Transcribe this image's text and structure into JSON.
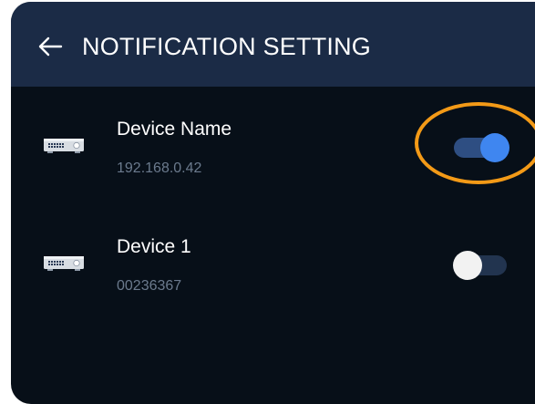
{
  "header": {
    "title": "NOTIFICATION SETTING",
    "back_icon": "arrow-left-icon"
  },
  "devices": [
    {
      "name": "Device Name",
      "sub": "192.168.0.42",
      "icon": "dvr-recorder-icon",
      "enabled": true
    },
    {
      "name": "Device 1",
      "sub": "00236367",
      "icon": "dvr-recorder-icon",
      "enabled": false
    }
  ],
  "colors": {
    "header_bg": "#1b2b46",
    "body_bg": "#070f18",
    "toggle_on_knob": "#3f86f0",
    "toggle_on_track": "#2e4e82",
    "toggle_off_knob": "#f2f2f2",
    "toggle_off_track": "#22344f",
    "highlight_ring": "#f39a17",
    "subtext": "#6b7a8d"
  }
}
